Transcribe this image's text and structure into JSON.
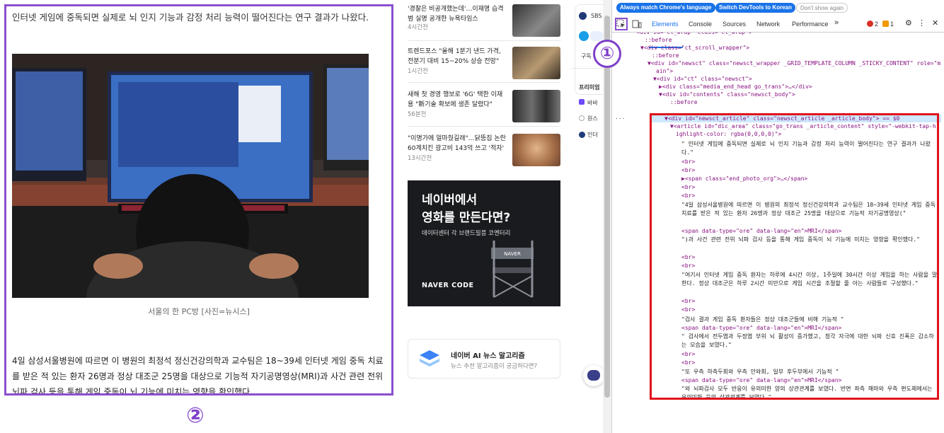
{
  "article": {
    "intro": "인터넷 게임에 중독되면 실제로 뇌 인지 기능과 감정 처리 능력이 떨어진다는 연구 결과가 나왔다.",
    "photo_caption": "서울의 한 PC방 [사진=뉴시스]",
    "body": "4일 삼성서울병원에 따르면 이 병원의 최정석 정신건강의학과 교수팀은 18~39세 인터넷 게임 중독 치료를 받은 적 있는 환자 26명과 정상 대조군 25명을 대상으로 기능적 자기공명영상(MRI)과 사건 관련 전위 뇌파 검사 등을 통해 게임 중독이 뇌 기능에 미치는 영향을 확인했다."
  },
  "markers": {
    "one": "①",
    "two": "②"
  },
  "news": [
    {
      "title": "'경찰은 비공개했는데'…이재명 습격범 실명 공개한 뉴욕타임스",
      "time": "4시간전"
    },
    {
      "title": "트렌드포스 \"올해 1분기 낸드 가격, 전분기 대비 15~20% 상승 전망\"",
      "time": "1시간전"
    },
    {
      "title": "새해 첫 경영 행보로 '6G' 택한 이재용 \"新기술 확보에 생존 달렸다\"",
      "time": "56분전"
    },
    {
      "title": "\"이명가에 얼마줬길래\"…닭뜽집 논란 60계치킨 광고비 143억 쓰고 '적자'",
      "time": "13시간전"
    }
  ],
  "ad": {
    "headline_1": "네이버에서",
    "headline_2": "영화를 만든다면?",
    "sub": "데이터센터 각 브랜드필름 코멘터리",
    "footer": "NAVER CODE",
    "chair_label": "NAVER"
  },
  "algo_card": {
    "title": "네이버 AI 뉴스 알고리즘",
    "sub": "뉴스 추천 알고리즘이 궁금하다면?"
  },
  "side": {
    "sbs": "SBS",
    "gudok": "구독",
    "premium": "프리미엄",
    "item1": "바바",
    "item2": "원스",
    "item3": "인더"
  },
  "devtools": {
    "info_btn_1": "Always match Chrome's language",
    "info_btn_2": "Switch DevTools to Korean",
    "info_btn_3": "Don't show again",
    "tabs": [
      "Elements",
      "Console",
      "Sources",
      "Network",
      "Performance"
    ],
    "more_tabs": "»",
    "error_count": "2",
    "warning_count": "1",
    "tree_lines": [
      {
        "indent": 34,
        "html": "<div id=\"ct_wrap\" class=\"ct_wrap\">"
      },
      {
        "indent": 46,
        "html": "::before"
      },
      {
        "indent": 40,
        "html": "▼<div class=\"ct_scroll_wrapper\">"
      },
      {
        "indent": 56,
        "html": "::before"
      },
      {
        "indent": 50,
        "html": "▼<div id=\"newsct\" class=\"newsct_wrapper _GRID_TEMPLATE_COLUMN _STICKY_CONTENT\" role=\"m"
      },
      {
        "indent": 62,
        "html": "ain\">"
      },
      {
        "indent": 58,
        "html": "▼<div id=\"ct\" class=\"newsct\">"
      },
      {
        "indent": 66,
        "html": "▶<div class=\"media_end_head go_trans\">…</div>"
      },
      {
        "indent": 66,
        "html": "▼<div id=\"contents\" class=\"newsct_body\">"
      },
      {
        "indent": 82,
        "html": "::before"
      },
      {
        "indent": 74,
        "html": "▼<div id=\"newsct_article\" class=\"newsct_article _article_body\"> == $0"
      },
      {
        "indent": 82,
        "html": "▼<article id=\"dic_area\" class=\"go_trans _article_content\" style=\"-webkit-tap-h"
      },
      {
        "indent": 90,
        "html": "ighlight-color: rgba(0,0,0,0)\">"
      }
    ],
    "dom_texts": [
      "\" 인터넷 게임에 중독되면 실제로 뇌 인지 기능과 감정 처리 능력이 떨어진다는 연구 결과가 나왔다.\"",
      "<br>",
      "<br>",
      "▶<span class=\"end_photo_org\">…</span>",
      "<br>",
      "<br>",
      "\"4일 삼성서울병원에 따르면 이 병원의 최정석 정신건강의학과 교수팀은 18~39세 인터넷 게임 중독 치료를 받은 적 있는 환자 26명과 정상 대조군 25명을 대상으로 기능적 자기공명영상(\"",
      "<span data-type=\"ore\" data-lang=\"en\">MRI</span>",
      "\")과 사건 관련 전위 뇌파 검사 등을 통해 게임 중독이 뇌 기능에 미치는 영향을 확인했다.\"",
      "<br>",
      "<br>",
      "\"여기서 인터넷 게임 중독 환자는 하루에 4시간 이상, 1주일에 30시간 이상 게임을 하는 사람을 말한다. 정상 대조군은 하루 2시간 미만으로 게임 시간을 조절할 줄 아는 사람들로 구성했다.\"",
      "<br>",
      "<br>",
      "\"검사 결과 게임 중독 환자들은 정상 대조군들에 비해 기능적 \"",
      "<span data-type=\"ore\" data-lang=\"en\">MRI</span>",
      "\" 검사에서 전두엽과 두정엽 부위 뇌 활성이 증가했고, 청각 자극에 대한 뇌파 신호 진폭은 감소하는 모습을 보였다.\"",
      "<br>",
      "<br>",
      "\"또 우측 하측두회와 우측 안와회, 일부 후두부에서 기능적 \"",
      "<span data-type=\"ore\" data-lang=\"en\">MRI</span>",
      "\"와 뇌파검사 모두 반응이 유의미한 양의 상관관계를 보였다. 반면 좌측 해마와 우측 편도체에서는 유의미한 음의 상관관계를 보였다.\""
    ]
  },
  "colors": {
    "purple": "#8a4fcf",
    "red": "#e0121b",
    "devtools_blue": "#1a73e8"
  }
}
